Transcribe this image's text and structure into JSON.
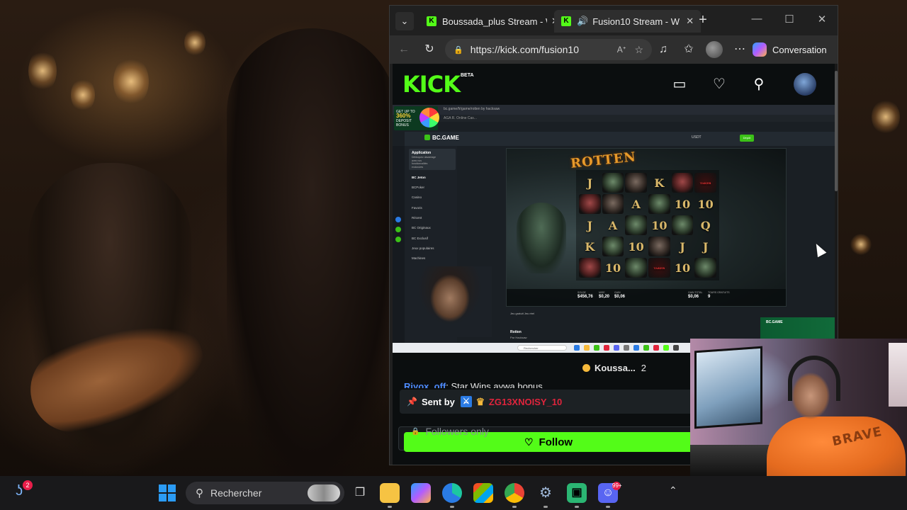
{
  "browser": {
    "tab_dropdown": "⌄",
    "tabs": [
      {
        "label": "Boussada_plus Stream - W",
        "close": "✕"
      },
      {
        "label": "Fusion10 Stream - W",
        "close": "✕",
        "audio": "🔊"
      }
    ],
    "new_tab": "+",
    "window_controls": {
      "minimize": "—",
      "maximize": "☐",
      "close": "✕"
    },
    "url": "https://kick.com/fusion10",
    "copilot_label": "Conversation"
  },
  "kick": {
    "logo": "KICK",
    "beta": "BETA"
  },
  "stream_video": {
    "promo": {
      "line1": "GET UP TO",
      "big": "360%",
      "line2": "DEPOSIT BONUS"
    },
    "inner_url": "bc.game/fr/game/rotten by hacksaw",
    "inner_tab": "AGA R. Online Cas...",
    "site_logo": "BC.GAME",
    "currency": "USDT",
    "deposit": "Dépôt",
    "app_promo": {
      "title": "Application",
      "subtitle": "Débloquez davantage avec nos fonctionnalités exclusives"
    },
    "sidebar": [
      "BC Jeton",
      "BCPoker",
      "Casino",
      "Favoris",
      "Récent",
      "BC Originaux",
      "BC Exclusif",
      "Jeux populaires",
      "Machines",
      "Bingo",
      "Jeux de table"
    ],
    "game_title": "ROTTEN",
    "game_stats": [
      {
        "label": "SOLDE",
        "value": "$456,76"
      },
      {
        "label": "MISE",
        "value": "$0,20"
      },
      {
        "label": "GAIN",
        "value": "$0,06"
      },
      {
        "label": "GAIN TOTAL",
        "value": "$0,06"
      },
      {
        "label": "TOURS GRATUITS",
        "value": "9"
      }
    ],
    "game_controls": "Jeu gratuit   Jeu réel",
    "game_name": "Rotten",
    "game_by": "Par Hacksaw",
    "banner": "BC.GAME",
    "inner_search": "Rechercher"
  },
  "chat": {
    "pinned_user": "Koussa...",
    "pinned_count": "2",
    "message_user": "Riyox_off",
    "message_text": ": Star Wins aywa bonus",
    "sent_by_label": "Sent by",
    "sent_by_user": "ZG13XNOISY_10",
    "followers_only": "Followers only",
    "follow_button": "Follow"
  },
  "facecam": {
    "shirt_text": "BRAVE"
  },
  "taskbar": {
    "widget_badge": "2",
    "search_placeholder": "Rechercher",
    "discord_badge": "99+"
  }
}
